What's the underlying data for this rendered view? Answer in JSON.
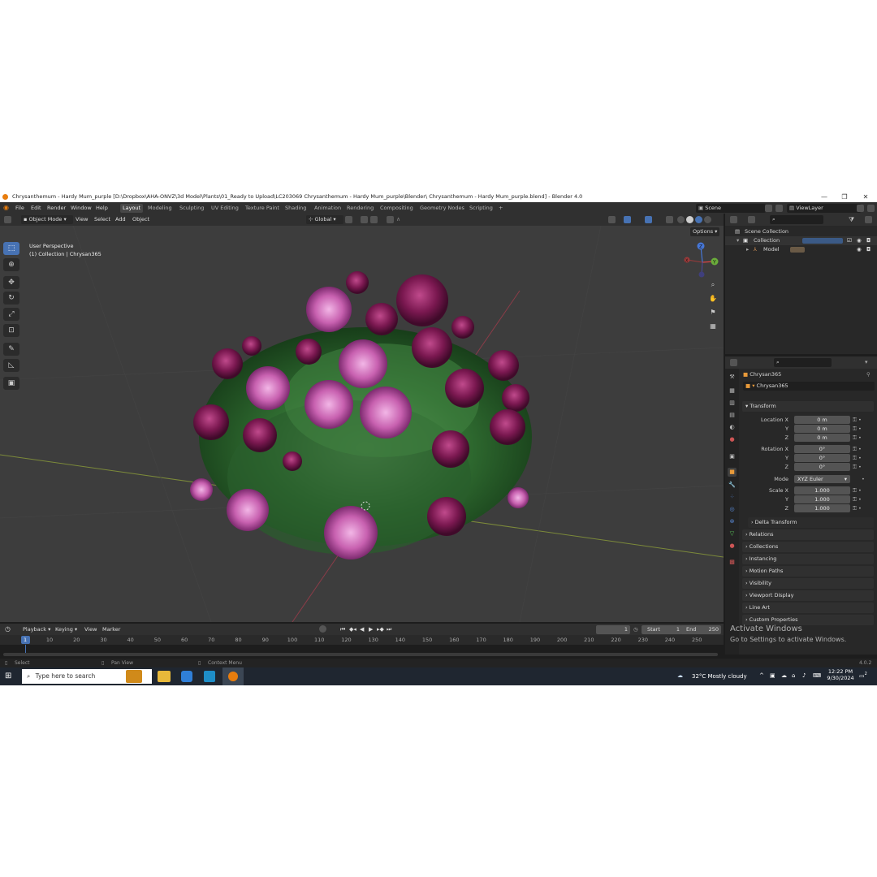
{
  "window": {
    "title": "Chrysanthemum - Hardy Mum_purple [D:\\Dropbox\\AHA-ONVZ\\3d Model\\Plants\\01_Ready to Upload\\LC203069 Chrysanthemum - Hardy Mum_purple\\Blender\\ Chrysanthemum - Hardy Mum_purple.blend] - Blender 4.0",
    "minimize": "—",
    "maximize": "❐",
    "close": "✕"
  },
  "menu": [
    "File",
    "Edit",
    "Render",
    "Window",
    "Help"
  ],
  "workspaces": {
    "active": "Layout",
    "tabs": [
      "Layout",
      "Modeling",
      "Sculpting",
      "UV Editing",
      "Texture Paint",
      "Shading",
      "Animation",
      "Rendering",
      "Compositing",
      "Geometry Nodes",
      "Scripting"
    ],
    "add": "+"
  },
  "scene": {
    "name": "Scene",
    "view_layer": "ViewLayer"
  },
  "viewport_header": {
    "mode": "Object Mode",
    "menus": [
      "View",
      "Select",
      "Add",
      "Object"
    ],
    "transform_orientation": "Global",
    "options": "Options"
  },
  "viewport": {
    "perspective": "User Perspective",
    "collection_info": "(1) Collection | Chrysan365"
  },
  "gizmo": {
    "x": "X",
    "y": "Y",
    "z": "Z"
  },
  "outliner": {
    "root": "Scene Collection",
    "collection": "Collection",
    "item": "Model"
  },
  "properties": {
    "object_name": "Chrysan365",
    "object_field": "Chrysan365",
    "transform_header": "Transform",
    "location": {
      "label": "Location X",
      "x": "0 m",
      "y": "0 m",
      "z": "0 m"
    },
    "rotation": {
      "label": "Rotation X",
      "x": "0°",
      "y": "0°",
      "z": "0°"
    },
    "mode": {
      "label": "Mode",
      "value": "XYZ Euler"
    },
    "scale": {
      "label": "Scale X",
      "x": "1.000",
      "y": "1.000",
      "z": "1.000"
    },
    "axis_y": "Y",
    "axis_z": "Z",
    "delta_transform": "Delta Transform",
    "panels": [
      "Relations",
      "Collections",
      "Instancing",
      "Motion Paths",
      "Visibility",
      "Viewport Display",
      "Line Art",
      "Custom Properties"
    ]
  },
  "timeline": {
    "menus": [
      "Playback",
      "Keying",
      "View",
      "Marker"
    ],
    "current_frame": "1",
    "start_label": "Start",
    "start": "1",
    "end_label": "End",
    "end": "250",
    "ticks": [
      "1",
      "10",
      "20",
      "30",
      "40",
      "50",
      "60",
      "70",
      "80",
      "90",
      "100",
      "110",
      "120",
      "130",
      "140",
      "150",
      "160",
      "170",
      "180",
      "190",
      "200",
      "210",
      "220",
      "230",
      "240",
      "250"
    ]
  },
  "statusbar": {
    "select": "Select",
    "pan": "Pan View",
    "context": "Context Menu",
    "version": "4.0.2"
  },
  "activate_windows": {
    "title": "Activate Windows",
    "subtitle": "Go to Settings to activate Windows."
  },
  "taskbar": {
    "search_placeholder": "Type here to search",
    "weather": "32°C  Mostly cloudy",
    "time": "12:22 PM",
    "date": "9/30/2024",
    "notifications": "2"
  },
  "colors": {
    "accent": "#4772b3",
    "orange": "#e87d0d",
    "panel": "#303030",
    "viewport": "#3d3d3d"
  }
}
